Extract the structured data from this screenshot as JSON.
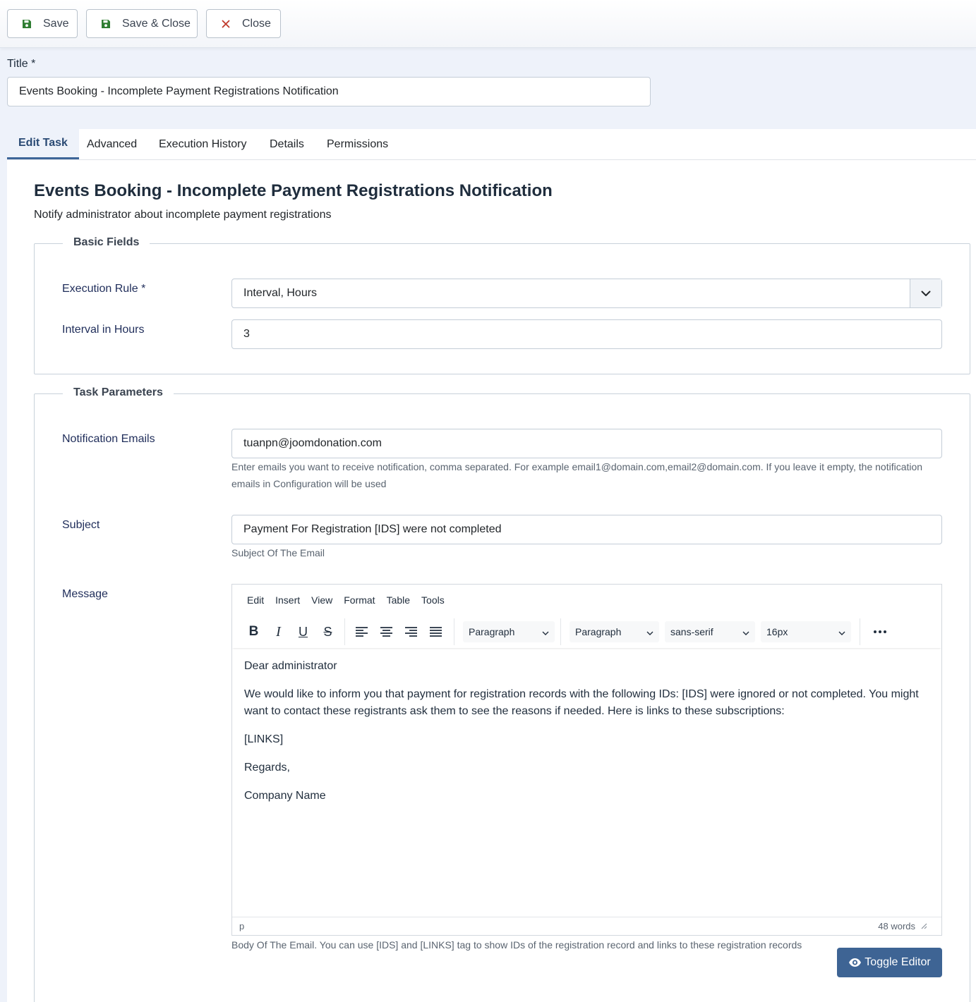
{
  "toolbar": {
    "save_label": "Save",
    "save_close_label": "Save & Close",
    "close_label": "Close"
  },
  "title_field": {
    "label": "Title *",
    "value": "Events Booking - Incomplete Payment Registrations Notification"
  },
  "tabs": [
    {
      "label": "Edit Task",
      "active": true
    },
    {
      "label": "Advanced",
      "active": false
    },
    {
      "label": "Execution History",
      "active": false
    },
    {
      "label": "Details",
      "active": false
    },
    {
      "label": "Permissions",
      "active": false
    }
  ],
  "task": {
    "heading": "Events Booking - Incomplete Payment Registrations Notification",
    "description": "Notify administrator about incomplete payment registrations"
  },
  "basic_fields": {
    "legend": "Basic Fields",
    "execution_rule_label": "Execution Rule *",
    "execution_rule_value": "Interval, Hours",
    "interval_label": "Interval in Hours",
    "interval_value": "3"
  },
  "task_parameters": {
    "legend": "Task Parameters",
    "emails_label": "Notification Emails",
    "emails_value": "tuanpn@joomdonation.com",
    "emails_hint": "Enter emails you want to receive notification, comma separated. For example email1@domain.com,email2@domain.com. If you leave it empty, the notification emails in Configuration will be used",
    "subject_label": "Subject",
    "subject_value": "Payment For Registration [IDS] were not completed",
    "subject_hint": "Subject Of The Email",
    "message_label": "Message",
    "message_hint": "Body Of The Email. You can use [IDS] and [LINKS] tag to show IDs of the registration record and links to these registration records"
  },
  "editor": {
    "menu": [
      "Edit",
      "Insert",
      "View",
      "Format",
      "Table",
      "Tools"
    ],
    "block_format": "Paragraph",
    "style_format": "Paragraph",
    "font_family": "sans-serif",
    "font_size": "16px",
    "body": [
      "Dear administrator",
      "We would like to inform you that payment for registration records with the following IDs: [IDS] were ignored or not completed. You might want to contact these registrants ask them to see the reasons if needed. Here is links to these subscriptions:",
      "[LINKS]",
      "Regards,",
      "Company Name"
    ],
    "status_path": "p",
    "word_count": "48 words"
  },
  "toggle_editor_label": "Toggle Editor",
  "colors": {
    "accent": "#3e6494",
    "save_icon": "#2f7d32",
    "close_icon": "#c0392b"
  }
}
